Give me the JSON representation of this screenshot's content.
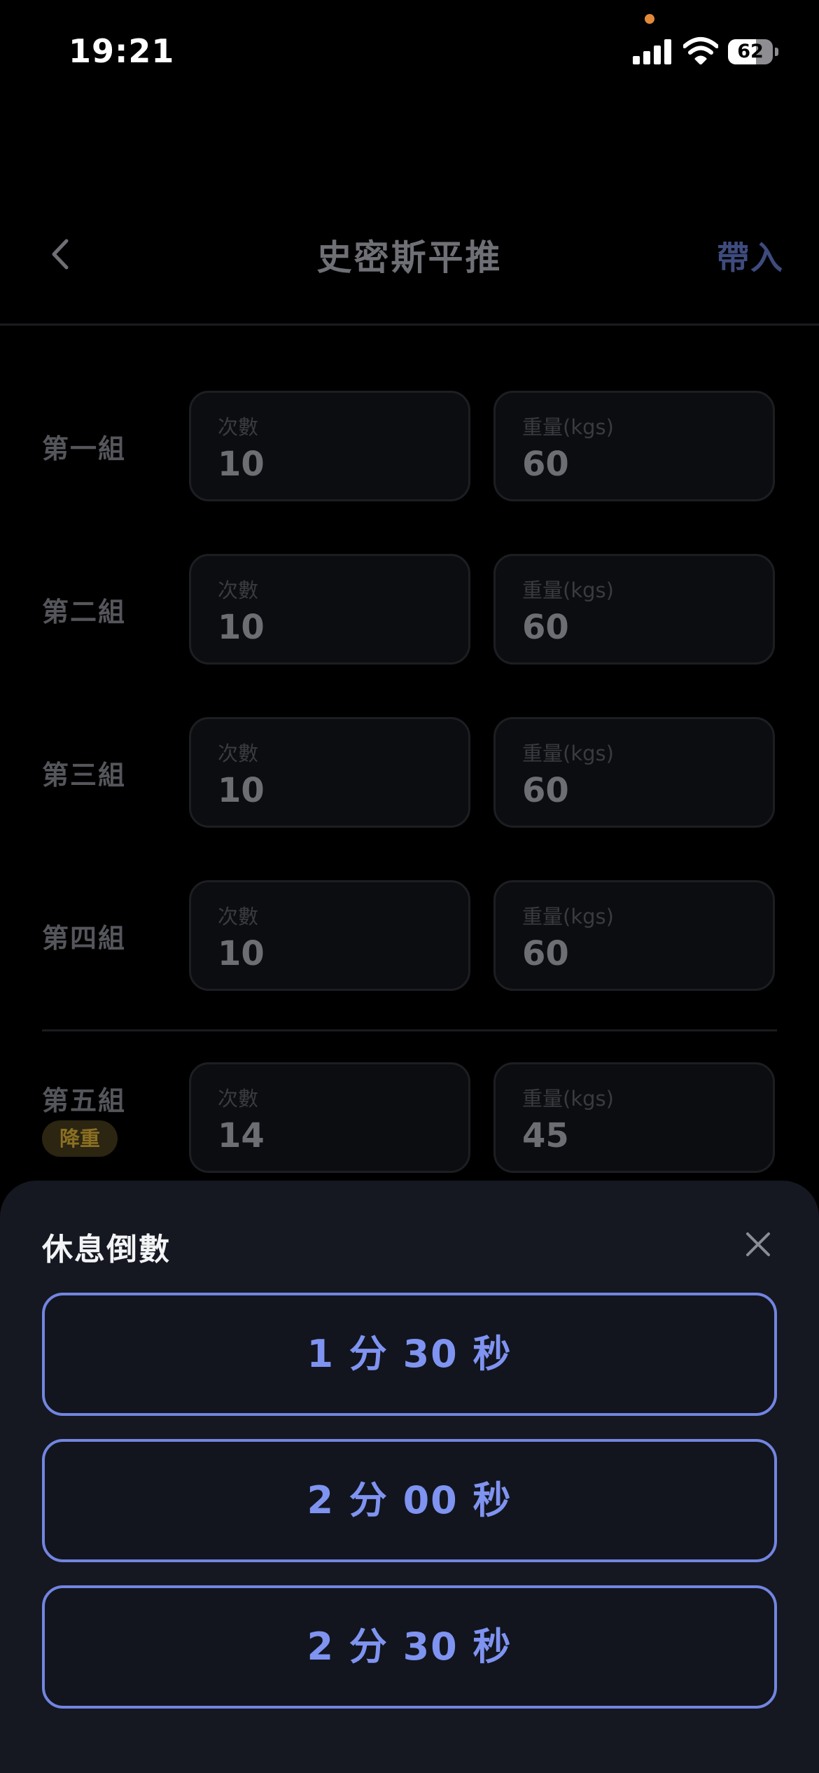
{
  "status_bar": {
    "time": "19:21",
    "battery_level": "62",
    "battery_fraction": 0.62,
    "icons": [
      "signal-icon",
      "wifi-icon",
      "battery-icon"
    ],
    "privacy_dot_color": "#e3893a"
  },
  "nav": {
    "back_icon": "chevron-left-icon",
    "title": "史密斯平推",
    "action_label": "帶入"
  },
  "sets": [
    {
      "label": "第一組",
      "reps_label": "次數",
      "reps": "10",
      "weight_label": "重量(kgs)",
      "weight": "60"
    },
    {
      "label": "第二組",
      "reps_label": "次數",
      "reps": "10",
      "weight_label": "重量(kgs)",
      "weight": "60"
    },
    {
      "label": "第三組",
      "reps_label": "次數",
      "reps": "10",
      "weight_label": "重量(kgs)",
      "weight": "60"
    },
    {
      "label": "第四組",
      "reps_label": "次數",
      "reps": "10",
      "weight_label": "重量(kgs)",
      "weight": "60"
    },
    {
      "label": "第五組",
      "badge": "降重",
      "reps_label": "次數",
      "reps": "14",
      "weight_label": "重量(kgs)",
      "weight": "45"
    }
  ],
  "rest_sheet": {
    "title": "休息倒數",
    "close_icon": "close-icon",
    "options": [
      "1 分 30 秒",
      "2 分 00 秒",
      "2 分 30 秒"
    ]
  },
  "colors": {
    "accent": "#7f93f0",
    "accent_border": "#7285e0",
    "sheet_background": "#151821",
    "dropset_badge": "#8b6f22"
  }
}
